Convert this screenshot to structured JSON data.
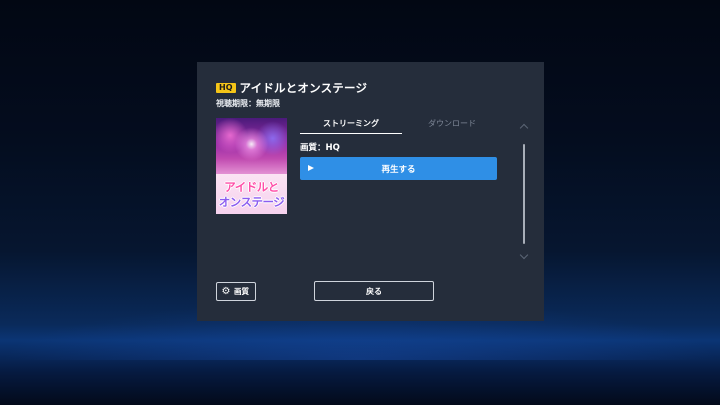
{
  "dialog": {
    "badge": "HQ",
    "title": "アイドルとオンステージ",
    "period": "視聴期限：無期限",
    "poster": {
      "line1": "アイドルと",
      "line2": "オンステージ"
    },
    "tabs": [
      {
        "label": "ストリーミング",
        "active": true
      },
      {
        "label": "ダウンロード",
        "active": false
      }
    ],
    "quality": "画質：HQ",
    "play_label": "再生する",
    "settings_label": "画質",
    "back_label": "戻る"
  },
  "colors": {
    "accent": "#2f8fe6",
    "badge": "#f5c518",
    "panel": "#252d3b"
  },
  "icons": {
    "play": "play-icon",
    "settings": "gear-icon",
    "scroll_up": "chevron-up-icon",
    "scroll_down": "chevron-down-icon"
  }
}
